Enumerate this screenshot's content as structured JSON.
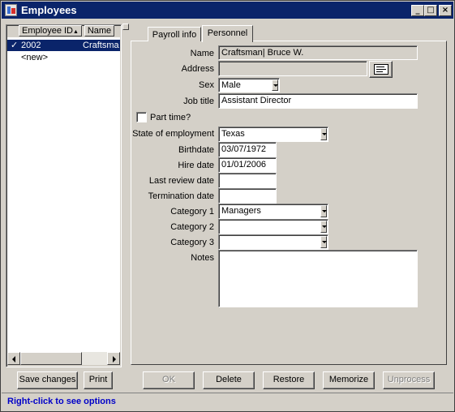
{
  "window": {
    "title": "Employees",
    "minimize_glyph": "_",
    "maximize_glyph": "□",
    "close_glyph": "×"
  },
  "list": {
    "columns": [
      {
        "label": "Employee ID",
        "sort_indicator": "▲"
      },
      {
        "label": "Name"
      }
    ],
    "rows": [
      {
        "check": "✓",
        "id": "2002",
        "name": "Craftsma",
        "selected": true
      },
      {
        "check": "",
        "id": "<new>",
        "name": "",
        "selected": false
      }
    ],
    "save_changes_label": "Save changes",
    "print_label": "Print"
  },
  "tabs": [
    {
      "label": "Payroll info",
      "active": false
    },
    {
      "label": "Personnel",
      "active": true
    }
  ],
  "form": {
    "name_label": "Name",
    "name_value": "Craftsman| Bruce W.",
    "address_label": "Address",
    "address_value": "",
    "sex_label": "Sex",
    "sex_value": "Male",
    "job_title_label": "Job title",
    "job_title_value": "Assistant Director",
    "part_time_label": "Part time?",
    "part_time_checked": false,
    "state_label": "State of employment",
    "state_value": "Texas",
    "birthdate_label": "Birthdate",
    "birthdate_value": "03/07/1972",
    "hire_date_label": "Hire date",
    "hire_date_value": "01/01/2006",
    "last_review_label": "Last review date",
    "last_review_value": "",
    "termination_label": "Termination date",
    "termination_value": "",
    "category1_label": "Category 1",
    "category1_value": "Managers",
    "category2_label": "Category 2",
    "category2_value": "",
    "category3_label": "Category 3",
    "category3_value": "",
    "notes_label": "Notes",
    "notes_value": ""
  },
  "actions": {
    "ok_label": "OK",
    "delete_label": "Delete",
    "restore_label": "Restore",
    "memorize_label": "Memorize",
    "unprocess_label": "Unprocess"
  },
  "status_text": "Right-click to see options",
  "colors": {
    "titlebar": "#0a246a",
    "selection": "#0a246a",
    "status_text": "#0000c8",
    "window_face": "#d4d0c8"
  }
}
